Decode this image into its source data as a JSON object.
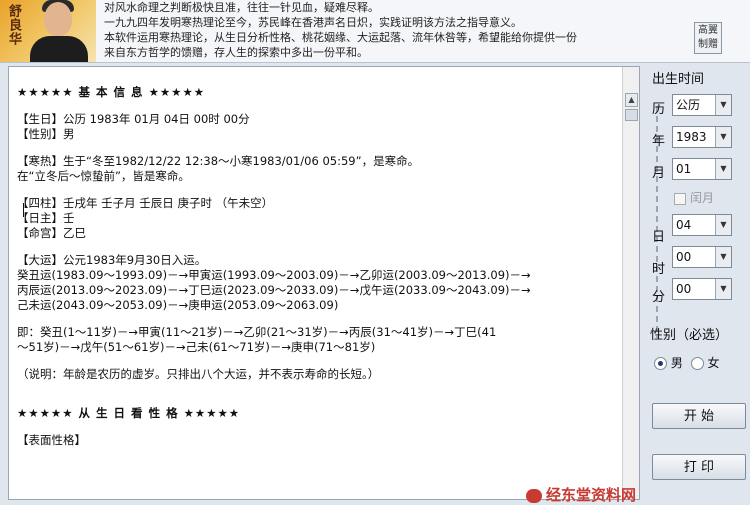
{
  "banner": {
    "signature": "舒良华",
    "intro_lines": [
      "对风水命理之判断极快且准，往往一针见血，疑难尽释。",
      "      一九九四年发明寒热理论至今，苏民峰在香港声名日炽，实践证明该方法之指导意义。",
      "      本软件运用寒热理论，从生日分析性格、桃花姻缘、大运起落、流年休咎等，希望能给你提供一份",
      "来自东方哲学的馈赠，存人生的探索中多出一份平和。"
    ],
    "dedicated_button": [
      "高翼",
      "制赠"
    ]
  },
  "report": {
    "lines": [
      {
        "t": "★★★★★  基  本  信  息  ★★★★★",
        "cls": "hdr"
      },
      {
        "t": "",
        "cls": "gap"
      },
      {
        "t": "【生日】公历 1983年 01月 04日 00时 00分",
        "cls": ""
      },
      {
        "t": "【性别】男",
        "cls": ""
      },
      {
        "t": "",
        "cls": "gap"
      },
      {
        "t": "【寒热】生于“冬至1982/12/22 12:38～小寒1983/01/06 05:59”，是寒命。",
        "cls": ""
      },
      {
        "t": "在“立冬后～惊蛰前”，皆是寒命。",
        "cls": ""
      },
      {
        "t": "",
        "cls": "gap"
      },
      {
        "t": "【四柱】壬戌年 壬子月 壬辰日 庚子时 （午未空）",
        "cls": ""
      },
      {
        "t": "【日主】壬",
        "cls": ""
      },
      {
        "t": "【命宫】乙巳",
        "cls": ""
      },
      {
        "t": "",
        "cls": "gap"
      },
      {
        "t": "【大运】公元1983年9月30日入运。",
        "cls": ""
      },
      {
        "t": "癸丑运(1983.09～1993.09)－→甲寅运(1993.09～2003.09)－→乙卯运(2003.09～2013.09)－→",
        "cls": ""
      },
      {
        "t": "丙辰运(2013.09～2023.09)－→丁巳运(2023.09～2033.09)－→戊午运(2033.09～2043.09)－→",
        "cls": ""
      },
      {
        "t": "己未运(2043.09～2053.09)－→庚申运(2053.09～2063.09)",
        "cls": ""
      },
      {
        "t": "",
        "cls": "gap"
      },
      {
        "t": "即：癸丑(1～11岁)－→甲寅(11～21岁)－→乙卯(21～31岁)－→丙辰(31～41岁)－→丁巳(41",
        "cls": ""
      },
      {
        "t": "～51岁)－→戊午(51～61岁)－→己未(61～71岁)－→庚申(71～81岁)",
        "cls": ""
      },
      {
        "t": "",
        "cls": "gap"
      },
      {
        "t": "（说明：年龄是农历的虚岁。只排出八个大运，并不表示寿命的长短。）",
        "cls": ""
      },
      {
        "t": "",
        "cls": "gap"
      },
      {
        "t": "",
        "cls": "gap"
      },
      {
        "t": "★★★★★  从  生  日  看  性  格  ★★★★★",
        "cls": "hdr"
      },
      {
        "t": "",
        "cls": "gap"
      },
      {
        "t": "【表面性格】",
        "cls": ""
      }
    ]
  },
  "side": {
    "title": "出生时间",
    "calendar_label": "历",
    "calendar_value": "公历",
    "year_label": "年",
    "year_value": "1983",
    "month_label": "月",
    "month_value": "01",
    "leap_label": "闰月",
    "day_label": "日",
    "day_value": "04",
    "hour_label": "时",
    "hour_value": "00",
    "minute_label": "分",
    "minute_value": "00",
    "gender_title": "性别（必选）",
    "male_label": "男",
    "female_label": "女",
    "start_label": "开 始",
    "print_label": "打 印"
  },
  "watermark": {
    "text": "经东堂资料网"
  }
}
